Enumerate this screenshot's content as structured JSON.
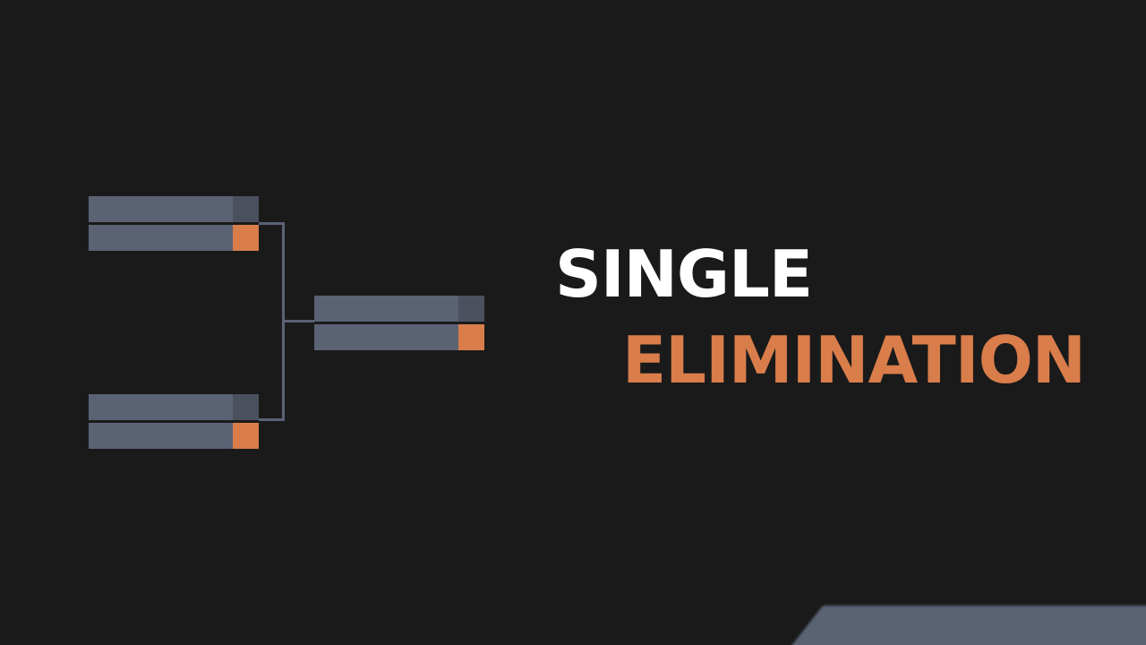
{
  "title": {
    "line1": "SINGLE",
    "line2": "ELIMINATION"
  },
  "colors": {
    "background": "#1a1a1a",
    "slot": "#5a6274",
    "slot_score_top": "#4a505e",
    "accent": "#d97d4b",
    "title_primary": "#ffffff"
  },
  "bracket": {
    "matches": [
      {
        "id": "match-1",
        "round": 1
      },
      {
        "id": "match-2",
        "round": 1
      },
      {
        "id": "match-3",
        "round": 2
      }
    ]
  }
}
